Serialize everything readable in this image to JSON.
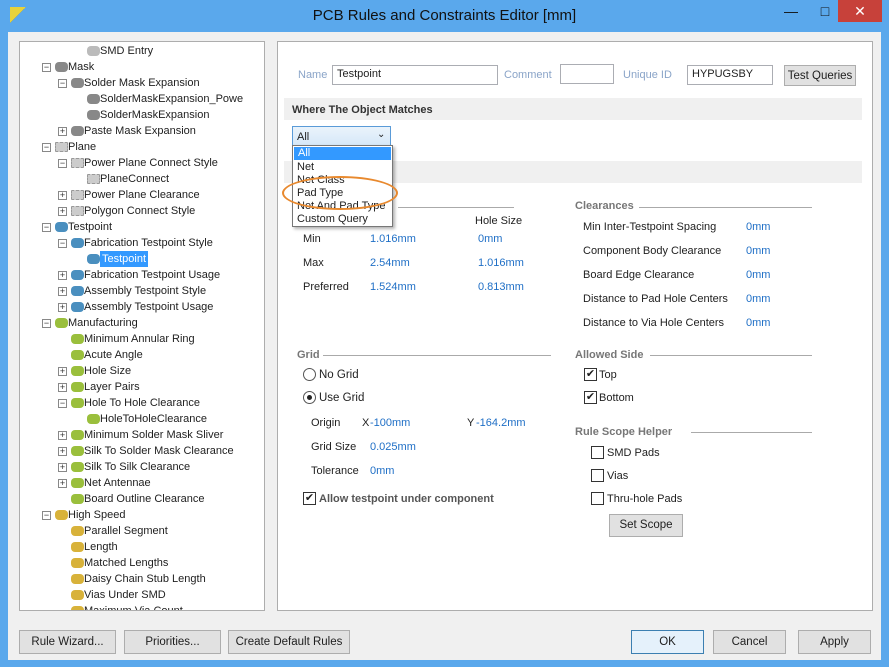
{
  "window": {
    "title": "PCB Rules and Constraints Editor [mm]",
    "minimize": "—",
    "maximize": "□",
    "close": "✕"
  },
  "tree": [
    {
      "label": "SMD Entry",
      "level": 2,
      "exp": "",
      "icon": "pill"
    },
    {
      "label": "Mask",
      "level": 0,
      "exp": "-",
      "icon": "mask"
    },
    {
      "label": "Solder Mask Expansion",
      "level": 1,
      "exp": "-",
      "icon": "mask"
    },
    {
      "label": "SolderMaskExpansion_Powe",
      "level": 2,
      "exp": "",
      "icon": "mask"
    },
    {
      "label": "SolderMaskExpansion",
      "level": 2,
      "exp": "",
      "icon": "mask"
    },
    {
      "label": "Paste Mask Expansion",
      "level": 1,
      "exp": "+",
      "icon": "mask"
    },
    {
      "label": "Plane",
      "level": 0,
      "exp": "-",
      "icon": "plane"
    },
    {
      "label": "Power Plane Connect Style",
      "level": 1,
      "exp": "-",
      "icon": "plane"
    },
    {
      "label": "PlaneConnect",
      "level": 2,
      "exp": "",
      "icon": "plane"
    },
    {
      "label": "Power Plane Clearance",
      "level": 1,
      "exp": "+",
      "icon": "plane"
    },
    {
      "label": "Polygon Connect Style",
      "level": 1,
      "exp": "+",
      "icon": "plane"
    },
    {
      "label": "Testpoint",
      "level": 0,
      "exp": "-",
      "icon": "testpoint"
    },
    {
      "label": "Fabrication Testpoint Style",
      "level": 1,
      "exp": "-",
      "icon": "testpoint"
    },
    {
      "label": "Testpoint",
      "level": 2,
      "exp": "",
      "icon": "testpoint",
      "selected": true
    },
    {
      "label": "Fabrication Testpoint Usage",
      "level": 1,
      "exp": "+",
      "icon": "testpoint"
    },
    {
      "label": "Assembly Testpoint Style",
      "level": 1,
      "exp": "+",
      "icon": "testpoint"
    },
    {
      "label": "Assembly Testpoint Usage",
      "level": 1,
      "exp": "+",
      "icon": "testpoint"
    },
    {
      "label": "Manufacturing",
      "level": 0,
      "exp": "-",
      "icon": "manufacturing"
    },
    {
      "label": "Minimum Annular Ring",
      "level": 1,
      "exp": "",
      "icon": "manufacturing"
    },
    {
      "label": "Acute Angle",
      "level": 1,
      "exp": "",
      "icon": "manufacturing"
    },
    {
      "label": "Hole Size",
      "level": 1,
      "exp": "+",
      "icon": "manufacturing"
    },
    {
      "label": "Layer Pairs",
      "level": 1,
      "exp": "+",
      "icon": "manufacturing"
    },
    {
      "label": "Hole To Hole Clearance",
      "level": 1,
      "exp": "-",
      "icon": "manufacturing"
    },
    {
      "label": "HoleToHoleClearance",
      "level": 2,
      "exp": "",
      "icon": "manufacturing"
    },
    {
      "label": "Minimum Solder Mask Sliver",
      "level": 1,
      "exp": "+",
      "icon": "manufacturing"
    },
    {
      "label": "Silk To Solder Mask Clearance",
      "level": 1,
      "exp": "+",
      "icon": "manufacturing"
    },
    {
      "label": "Silk To Silk Clearance",
      "level": 1,
      "exp": "+",
      "icon": "manufacturing"
    },
    {
      "label": "Net Antennae",
      "level": 1,
      "exp": "+",
      "icon": "manufacturing"
    },
    {
      "label": "Board Outline Clearance",
      "level": 1,
      "exp": "",
      "icon": "manufacturing"
    },
    {
      "label": "High Speed",
      "level": 0,
      "exp": "-",
      "icon": "highspeed"
    },
    {
      "label": "Parallel Segment",
      "level": 1,
      "exp": "",
      "icon": "highspeed"
    },
    {
      "label": "Length",
      "level": 1,
      "exp": "",
      "icon": "highspeed"
    },
    {
      "label": "Matched Lengths",
      "level": 1,
      "exp": "",
      "icon": "highspeed"
    },
    {
      "label": "Daisy Chain Stub Length",
      "level": 1,
      "exp": "",
      "icon": "highspeed"
    },
    {
      "label": "Vias Under SMD",
      "level": 1,
      "exp": "",
      "icon": "highspeed"
    },
    {
      "label": "Maximum Via Count",
      "level": 1,
      "exp": "",
      "icon": "highspeed"
    }
  ],
  "rule": {
    "name_label": "Name",
    "name": "Testpoint",
    "comment_label": "Comment",
    "comment": "",
    "uid_label": "Unique ID",
    "uid": "HYPUGSBY",
    "test_queries": "Test Queries"
  },
  "match": {
    "header": "Where The Object Matches",
    "selected": "All",
    "options": [
      "All",
      "Net",
      "Net Class",
      "Pad Type",
      "Net And Pad Type",
      "Custom Query"
    ]
  },
  "size": {
    "hole_header": "Hole Size",
    "rows": [
      {
        "label": "Min",
        "size": "1.016mm",
        "hole": "0mm"
      },
      {
        "label": "Max",
        "size": "2.54mm",
        "hole": "1.016mm"
      },
      {
        "label": "Preferred",
        "size": "1.524mm",
        "hole": "0.813mm"
      }
    ]
  },
  "clearances": {
    "title": "Clearances",
    "rows": [
      {
        "label": "Min Inter-Testpoint Spacing",
        "value": "0mm"
      },
      {
        "label": "Component Body Clearance",
        "value": "0mm"
      },
      {
        "label": "Board Edge Clearance",
        "value": "0mm"
      },
      {
        "label": "Distance to Pad Hole Centers",
        "value": "0mm"
      },
      {
        "label": "Distance to Via Hole Centers",
        "value": "0mm"
      }
    ]
  },
  "grid": {
    "title": "Grid",
    "no_grid": "No Grid",
    "use_grid": "Use Grid",
    "origin": "Origin",
    "x_label": "X",
    "x": "-100mm",
    "y_label": "Y",
    "y": "-164.2mm",
    "size_label": "Grid Size",
    "size": "0.025mm",
    "tol_label": "Tolerance",
    "tol": "0mm",
    "allow": "Allow testpoint under component"
  },
  "side": {
    "title": "Allowed Side",
    "top": "Top",
    "bottom": "Bottom"
  },
  "scope": {
    "title": "Rule Scope Helper",
    "smd": "SMD Pads",
    "vias": "Vias",
    "thru": "Thru-hole Pads",
    "set": "Set Scope"
  },
  "footer": {
    "wizard": "Rule Wizard...",
    "priorities": "Priorities...",
    "defaults": "Create Default Rules",
    "ok": "OK",
    "cancel": "Cancel",
    "apply": "Apply"
  },
  "colors": {
    "accent": "#3399ff",
    "value": "#1f6fc6",
    "highlight": "#e8892e"
  }
}
